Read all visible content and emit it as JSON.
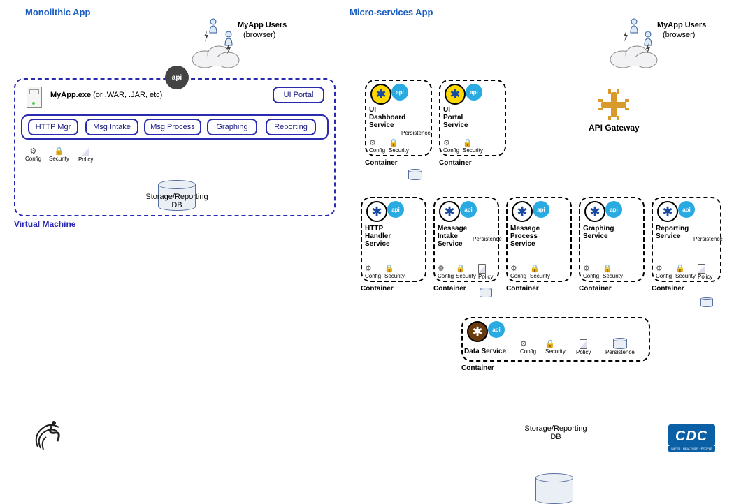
{
  "left": {
    "heading": "Monolithic App",
    "users_title": "MyApp Users",
    "users_sub": "(browser)",
    "api_badge": "api",
    "app_name": "MyApp.exe",
    "app_suffix": " (or .WAR, .JAR, etc)",
    "ui_portal": "UI Portal",
    "modules": [
      "HTTP Mgr",
      "Msg Intake",
      "Msg Process",
      "Graphing",
      "Reporting"
    ],
    "config": "Config",
    "security": "Security",
    "policy": "Policy",
    "db_label": "Storage/Reporting\nDB",
    "vm_label": "Virtual Machine"
  },
  "right": {
    "heading": "Micro-services App",
    "users_title": "MyApp Users",
    "users_sub": "(browser)",
    "api_gateway": "API Gateway",
    "container_label": "Container",
    "api_badge": "api",
    "config": "Config",
    "security": "Security",
    "policy": "Policy",
    "persistence": "Persistence",
    "db_label": "Storage/Reporting\nDB",
    "services_row1": [
      {
        "name": "UI\nDashboard\nService",
        "persist": true,
        "policy": false,
        "badge": "yellow"
      },
      {
        "name": "UI\nPortal\nService",
        "persist": false,
        "policy": false,
        "badge": "yellow"
      }
    ],
    "services_row2": [
      {
        "name": "HTTP\nHandler\nService",
        "persist": false,
        "policy": false,
        "badge": "white"
      },
      {
        "name": "Message\nIntake\nService",
        "persist": true,
        "policy": true,
        "badge": "white"
      },
      {
        "name": "Message\nProcess\nService",
        "persist": false,
        "policy": false,
        "badge": "white"
      },
      {
        "name": "Graphing\nService",
        "persist": false,
        "policy": false,
        "badge": "white"
      },
      {
        "name": "Reporting\nService",
        "persist": true,
        "policy": true,
        "badge": "white"
      }
    ],
    "data_service": {
      "name": "Data Service",
      "badge": "brown"
    }
  },
  "footer": {
    "cdc": "CDC",
    "cdc_sub": "SAFER · HEALTHIER · PEOPLE"
  }
}
